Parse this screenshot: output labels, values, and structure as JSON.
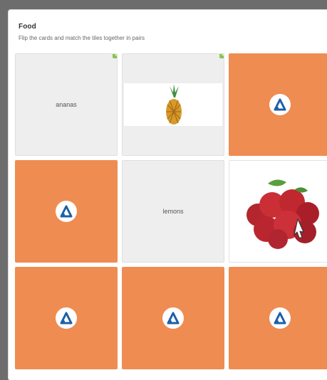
{
  "header": {
    "title": "Food",
    "subtitle": "Flip the cards and match the tiles together in pairs"
  },
  "grid": {
    "tiles": [
      {
        "label": "ananas",
        "badge": "1"
      },
      {
        "image": "pineapple",
        "badge": "1"
      },
      {
        "back_icon": "brand-icon"
      },
      {
        "back_icon": "brand-icon"
      },
      {
        "label": "lemons"
      },
      {
        "image": "apples"
      },
      {
        "back_icon": "brand-icon"
      },
      {
        "back_icon": "brand-icon"
      },
      {
        "back_icon": "brand-icon"
      }
    ]
  },
  "colors": {
    "card_back": "#ef8c52",
    "badge": "#8bc34a"
  }
}
